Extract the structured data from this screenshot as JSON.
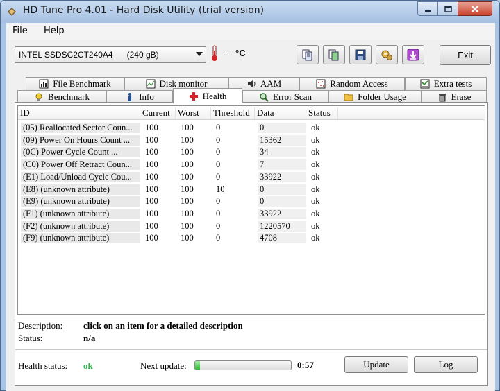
{
  "window": {
    "title": "HD Tune Pro 4.01 - Hard Disk Utility (trial version)",
    "minimize_icon": "minimize-icon",
    "maximize_icon": "maximize-icon",
    "close_icon": "close-icon"
  },
  "menu": {
    "file": "File",
    "help": "Help"
  },
  "toolbar": {
    "drive": "INTEL SSDSC2CT240A4      (240 gB)",
    "temperature": "--",
    "temperature_unit": "°C",
    "buttons": [
      "copy-info-icon",
      "copy-screenshot-icon",
      "save-icon",
      "options-icon",
      "download-icon"
    ],
    "exit_label": "Exit"
  },
  "tabs_top": [
    {
      "label": "File Benchmark",
      "icon": "file-benchmark-icon"
    },
    {
      "label": "Disk monitor",
      "icon": "disk-monitor-icon"
    },
    {
      "label": "AAM",
      "icon": "speaker-icon"
    },
    {
      "label": "Random Access",
      "icon": "random-access-icon"
    },
    {
      "label": "Extra tests",
      "icon": "extra-tests-icon"
    }
  ],
  "tabs_bottom": [
    {
      "label": "Benchmark",
      "icon": "benchmark-icon"
    },
    {
      "label": "Info",
      "icon": "info-icon"
    },
    {
      "label": "Health",
      "icon": "health-cross-icon",
      "active": true
    },
    {
      "label": "Error Scan",
      "icon": "magnifier-icon"
    },
    {
      "label": "Folder Usage",
      "icon": "folder-icon"
    },
    {
      "label": "Erase",
      "icon": "trash-icon"
    }
  ],
  "table": {
    "headers": [
      "ID",
      "Current",
      "Worst",
      "Threshold",
      "Data",
      "Status"
    ],
    "rows": [
      [
        "(05) Reallocated Sector Coun...",
        "100",
        "100",
        "0",
        "0",
        "ok"
      ],
      [
        "(09) Power On Hours Count   ...",
        "100",
        "100",
        "0",
        "15362",
        "ok"
      ],
      [
        "(0C) Power Cycle Count       ...",
        "100",
        "100",
        "0",
        "34",
        "ok"
      ],
      [
        "(C0) Power Off Retract Coun...",
        "100",
        "100",
        "0",
        "7",
        "ok"
      ],
      [
        "(E1) Load/Unload Cycle Cou...",
        "100",
        "100",
        "0",
        "33922",
        "ok"
      ],
      [
        "(E8) (unknown attribute)",
        "100",
        "100",
        "10",
        "0",
        "ok"
      ],
      [
        "(E9) (unknown attribute)",
        "100",
        "100",
        "0",
        "0",
        "ok"
      ],
      [
        "(F1) (unknown attribute)",
        "100",
        "100",
        "0",
        "33922",
        "ok"
      ],
      [
        "(F2) (unknown attribute)",
        "100",
        "100",
        "0",
        "1220570",
        "ok"
      ],
      [
        "(F9) (unknown attribute)",
        "100",
        "100",
        "0",
        "4708",
        "ok"
      ]
    ]
  },
  "details": {
    "description_label": "Description:",
    "description_value": "click on an item for a detailed description",
    "status_label": "Status:",
    "status_value": "n/a"
  },
  "footer": {
    "health_label": "Health status:",
    "health_value": "ok",
    "next_update_label": "Next update:",
    "progress": 0.05,
    "countdown": "0:57",
    "update_label": "Update",
    "log_label": "Log"
  },
  "colors": {
    "ok_green": "#2bb04a",
    "health_red": "#d9232b"
  }
}
